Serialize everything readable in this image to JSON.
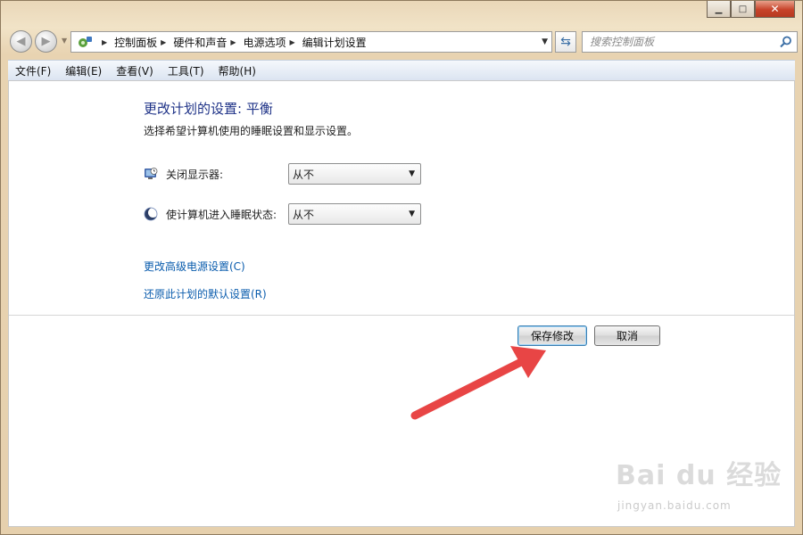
{
  "window": {
    "caption": {
      "minimize": "▁",
      "maximize": "□",
      "close": "✕"
    }
  },
  "nav": {
    "breadcrumbs": [
      "控制面板",
      "硬件和声音",
      "电源选项",
      "编辑计划设置"
    ],
    "search_placeholder": "搜索控制面板"
  },
  "menubar": {
    "items": [
      "文件(F)",
      "编辑(E)",
      "查看(V)",
      "工具(T)",
      "帮助(H)"
    ]
  },
  "main": {
    "title": "更改计划的设置: 平衡",
    "subtitle": "选择希望计算机使用的睡眠设置和显示设置。",
    "settings": [
      {
        "label": "关闭显示器:",
        "value": "从不",
        "icon": "monitor-clock-icon"
      },
      {
        "label": "使计算机进入睡眠状态:",
        "value": "从不",
        "icon": "sleep-moon-icon"
      }
    ],
    "links": {
      "advanced": "更改高级电源设置(C)",
      "restore": "还原此计划的默认设置(R)"
    },
    "buttons": {
      "save": "保存修改",
      "cancel": "取消"
    }
  },
  "annotation": {
    "arrow_color": "#e84545"
  },
  "watermark": {
    "logo": "Bai du 经验",
    "url": "jingyan.baidu.com"
  }
}
